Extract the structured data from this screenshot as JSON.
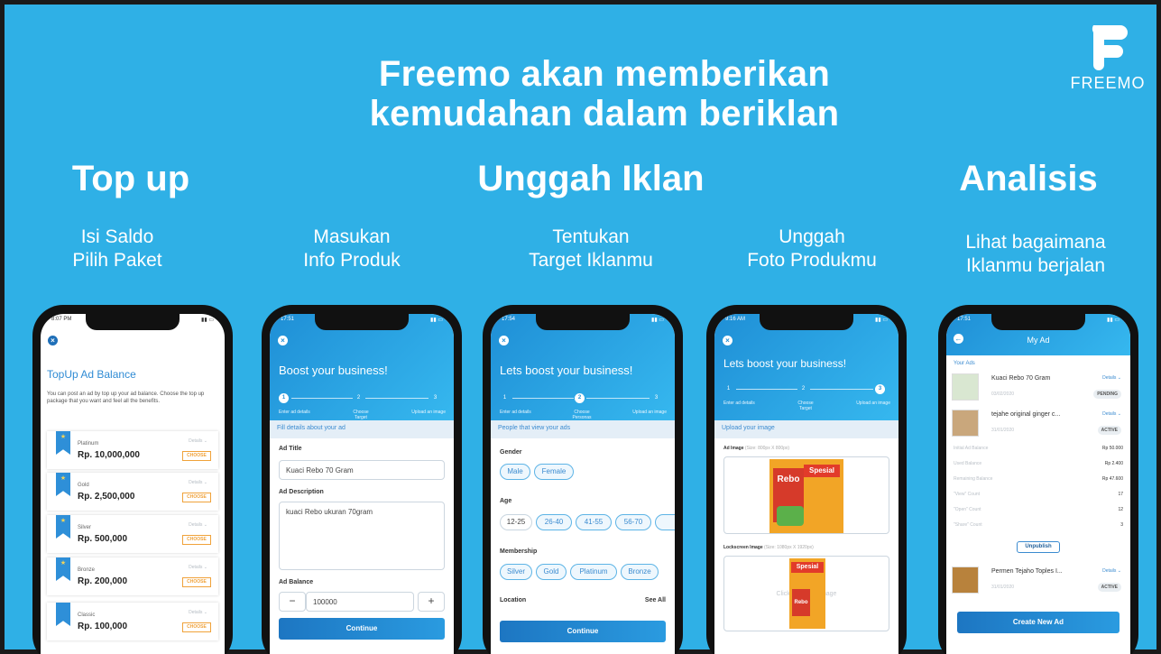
{
  "headline": "Freemo akan memberikan kemudahan dalam beriklan",
  "brand": {
    "word": "FREEMO"
  },
  "sections": {
    "topup": {
      "title": "Top up",
      "sub1": "Isi Saldo",
      "sub2": "Pilih Paket"
    },
    "unggah": {
      "title": "Unggah Iklan"
    },
    "analisis": {
      "title": "Analisis",
      "sub1": "Lihat bagaimana",
      "sub2": "Iklanmu berjalan"
    }
  },
  "subs": {
    "info": {
      "line1": "Masukan",
      "line2": "Info Produk"
    },
    "target": {
      "line1": "Tentukan",
      "line2": "Target Iklanmu"
    },
    "foto": {
      "line1": "Unggah",
      "line2": "Foto Produkmu"
    }
  },
  "phone1": {
    "time": "8:07 PM",
    "title": "TopUp Ad Balance",
    "desc": "You can post an ad by top up your ad balance. Choose the top up package that you want and feel all the benefits.",
    "details_label": "Details",
    "choose_label": "CHOOSE",
    "packages": [
      {
        "name": "Platinum",
        "price": "Rp. 10,000,000"
      },
      {
        "name": "Gold",
        "price": "Rp. 2,500,000"
      },
      {
        "name": "Silver",
        "price": "Rp. 500,000"
      },
      {
        "name": "Bronze",
        "price": "Rp. 200,000"
      },
      {
        "name": "Classic",
        "price": "Rp. 100,000"
      }
    ]
  },
  "phone2": {
    "time": "17:51",
    "title": "Boost your business!",
    "steps": [
      "Enter ad details",
      "Choose Target",
      "Upload an image"
    ],
    "section": "Fill details about your ad",
    "ad_title_label": "Ad Title",
    "ad_title_value": "Kuaci Rebo 70 Gram",
    "ad_desc_label": "Ad Description",
    "ad_desc_value": "kuaci Rebo ukuran 70gram",
    "balance_label": "Ad Balance",
    "balance_value": "100000",
    "continue": "Continue"
  },
  "phone3": {
    "time": "17:54",
    "title": "Lets boost your business!",
    "steps": [
      "Enter ad details",
      "Choose Personas",
      "Upload an image"
    ],
    "section": "People that view your ads",
    "gender_label": "Gender",
    "genders": [
      "Male",
      "Female"
    ],
    "age_label": "Age",
    "ages": [
      "12-25",
      "26-40",
      "41-55",
      "56-70"
    ],
    "membership_label": "Membership",
    "memberships": [
      "Silver",
      "Gold",
      "Platinum",
      "Bronze"
    ],
    "location_label": "Location",
    "see_all": "See All",
    "continue": "Continue"
  },
  "phone4": {
    "time": "9:16 AM",
    "title": "Lets boost your business!",
    "steps": [
      "Enter ad details",
      "Choose Target",
      "Upload an image"
    ],
    "section": "Upload your image",
    "ad_image_label": "Ad Image",
    "ad_image_size": "(Size: 800px X 800px)",
    "lockscreen_label": "Lockscreen Image",
    "lockscreen_size": "(Size: 1080px X 1920px)",
    "product_brand": "Rebo",
    "product_tag": "Spesial",
    "click_text": "Click to upload image"
  },
  "phone5": {
    "time": "17:51",
    "header": "My Ad",
    "your_ads": "Your Ads",
    "details": "Details",
    "ads": [
      {
        "name": "Kuaci Rebo 70 Gram",
        "date": "03/02/2020",
        "status": "PENDING"
      },
      {
        "name": "tejahe original ginger c...",
        "date": "31/01/2020",
        "status": "ACTIVE"
      }
    ],
    "stats": [
      {
        "label": "Initial Ad Balance",
        "value": "Rp 50.000"
      },
      {
        "label": "Used Balance",
        "value": "Rp 2.400"
      },
      {
        "label": "Remaining Balance",
        "value": "Rp 47.600"
      },
      {
        "label": "\"View\" Count",
        "value": "17"
      },
      {
        "label": "\"Open\" Count",
        "value": "12"
      },
      {
        "label": "\"Share\" Count",
        "value": "3"
      }
    ],
    "unpublish": "Unpublish",
    "ad3": {
      "name": "Permen Tejaho Toples I...",
      "date": "31/01/2020",
      "status": "ACTIVE"
    },
    "create": "Create New Ad"
  }
}
